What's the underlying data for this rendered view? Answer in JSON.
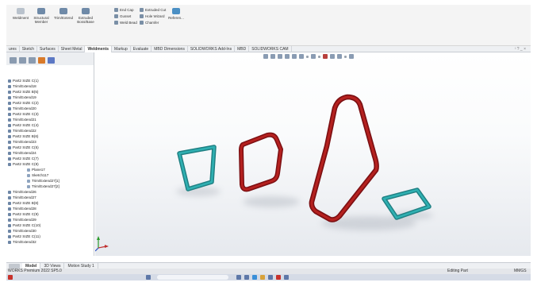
{
  "ribbon": {
    "big_buttons": [
      {
        "label": "Weldment",
        "icon": "weldment-icon",
        "disabled": true
      },
      {
        "label": "Structural Member",
        "icon": "structural-member-icon",
        "disabled": false
      },
      {
        "label": "Trim/Extend",
        "icon": "trim-extend-icon",
        "disabled": false
      },
      {
        "label": "Extruded Boss/Base",
        "icon": "extruded-boss-icon",
        "disabled": false
      }
    ],
    "small_buttons": [
      {
        "label": "End Cap",
        "icon": "end-cap-icon"
      },
      {
        "label": "Gusset",
        "icon": "gusset-icon"
      },
      {
        "label": "Weld Bead",
        "icon": "weld-bead-icon"
      },
      {
        "label": "Extruded Cut",
        "icon": "extruded-cut-icon"
      },
      {
        "label": "Hole Wizard",
        "icon": "hole-wizard-icon"
      },
      {
        "label": "Chamfer",
        "icon": "chamfer-icon"
      },
      {
        "label": "Referen...",
        "icon": "reference-geometry-icon"
      }
    ]
  },
  "command_tabs": [
    "ures",
    "Sketch",
    "Surfaces",
    "Sheet Metal",
    "Weldments",
    "Markup",
    "Evaluate",
    "MBD Dimensions",
    "SOLIDWORKS Add-Ins",
    "MBD",
    "SOLIDWORKS CAM"
  ],
  "active_command_tab": "Weldments",
  "window_controls": "ᴵ ? _ ×",
  "tree_items": [
    "Part2 SIZE C(1)",
    "Trim/Extend18",
    "Part2 SIZE B(5)",
    "Trim/Extend19",
    "Part2 SIZE C(2)",
    "Trim/Extend20",
    "Part2 SIZE C(3)",
    "Trim/Extend21",
    "Part2 SIZE C(4)",
    "Trim/Extend22",
    "Part2 SIZE B(6)",
    "Trim/Extend23",
    "Part2 SIZE C(5)",
    "Trim/Extend24",
    "Part2 SIZE C(7)",
    "Part2 SIZE C(8)"
  ],
  "tree_subitems": [
    "Plane17",
    "Sketch117",
    "Trim/Extend27[1]",
    "Trim/Extend27[2]"
  ],
  "tree_items_after": [
    "Trim/Extend26",
    "Trim/Extend27",
    "Part2 SIZE B(8)",
    "Trim/Extend28",
    "Part2 SIZE C(9)",
    "Trim/Extend29",
    "Part2 SIZE C(10)",
    "Trim/Extend30",
    "Part2 SIZE C(11)",
    "Trim/Extend32"
  ],
  "bottom_tabs": [
    "Model",
    "3D Views",
    "Motion Study 1"
  ],
  "active_bottom_tab": "Model",
  "status": {
    "left": "WORKS Premium 2022 SP5.0",
    "editing": "Editing Part",
    "units": "MMGS"
  },
  "colors": {
    "teal_frame": "#2a9a9c",
    "red_frame": "#a8191c"
  }
}
